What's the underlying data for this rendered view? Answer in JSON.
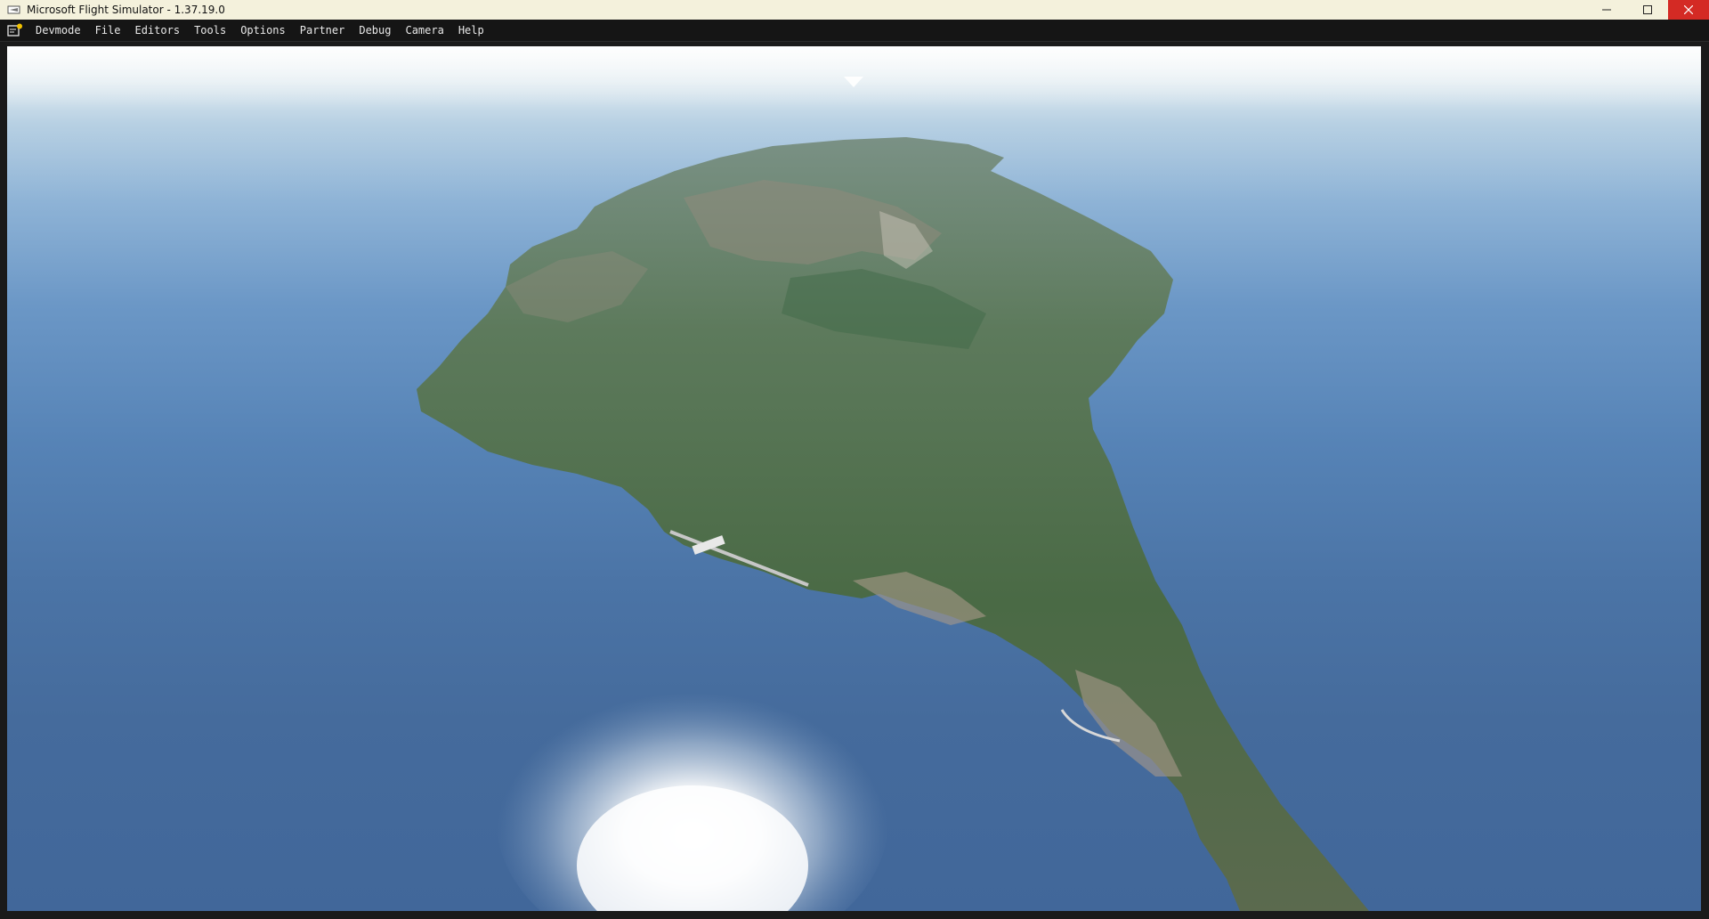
{
  "window": {
    "title": "Microsoft Flight Simulator - 1.37.19.0",
    "icon": "airplane-app-icon",
    "controls": [
      "minimize-icon",
      "maximize-icon",
      "close-icon"
    ]
  },
  "menubar": {
    "icon": "devmode-icon",
    "items": [
      {
        "label": "Devmode"
      },
      {
        "label": "File"
      },
      {
        "label": "Editors"
      },
      {
        "label": "Tools"
      },
      {
        "label": "Options"
      },
      {
        "label": "Partner"
      },
      {
        "label": "Debug"
      },
      {
        "label": "Camera"
      },
      {
        "label": "Help"
      }
    ]
  },
  "viewport": {
    "scene": "aerial-view-island",
    "colors": {
      "sky": "#f3f6f7",
      "ocean": "#4b74a6",
      "land": "#4f6b4e",
      "cloud": "#ffffff"
    }
  },
  "colors": {
    "titlebar": "#f4f1dc",
    "menubar": "#151515",
    "close_button": "#d42a24"
  }
}
